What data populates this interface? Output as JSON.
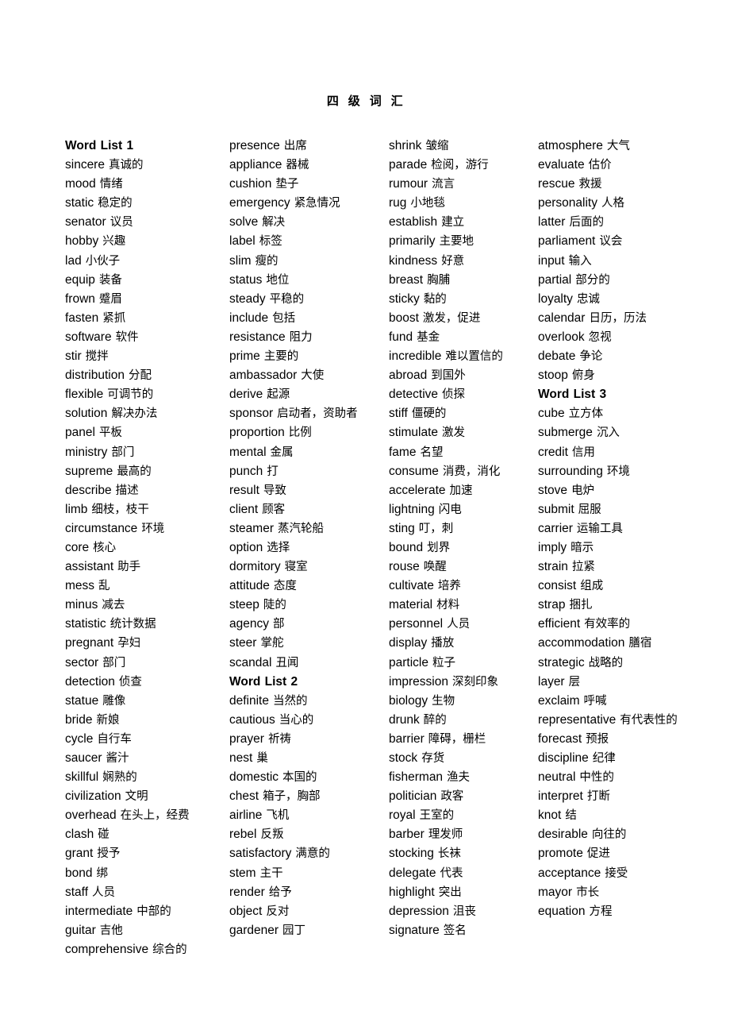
{
  "document": {
    "title": "四  级  词  汇"
  },
  "columns": [
    {
      "name": "column-1",
      "entries": [
        {
          "en": "Word List 1",
          "zh": "",
          "heading": true
        },
        {
          "en": "sincere",
          "zh": "真诚的"
        },
        {
          "en": "mood",
          "zh": "情绪"
        },
        {
          "en": "static",
          "zh": "稳定的"
        },
        {
          "en": "senator",
          "zh": "议员"
        },
        {
          "en": "hobby",
          "zh": "兴趣"
        },
        {
          "en": "lad",
          "zh": "小伙子"
        },
        {
          "en": "equip",
          "zh": "装备"
        },
        {
          "en": "frown",
          "zh": "蹙眉"
        },
        {
          "en": "fasten",
          "zh": "紧抓"
        },
        {
          "en": "software",
          "zh": "软件"
        },
        {
          "en": "stir",
          "zh": "搅拌"
        },
        {
          "en": "distribution",
          "zh": "分配"
        },
        {
          "en": "flexible",
          "zh": "可调节的"
        },
        {
          "en": "solution",
          "zh": "解决办法"
        },
        {
          "en": "panel",
          "zh": "平板"
        },
        {
          "en": "ministry",
          "zh": "部门"
        },
        {
          "en": "supreme",
          "zh": "最高的"
        },
        {
          "en": "describe",
          "zh": "描述"
        },
        {
          "en": "limb",
          "zh": "细枝，枝干"
        },
        {
          "en": "circumstance",
          "zh": "环境"
        },
        {
          "en": "core",
          "zh": "核心"
        },
        {
          "en": "assistant",
          "zh": "助手"
        },
        {
          "en": "mess",
          "zh": "乱"
        },
        {
          "en": "minus",
          "zh": "减去"
        },
        {
          "en": "statistic",
          "zh": "统计数据"
        },
        {
          "en": "pregnant",
          "zh": "孕妇"
        },
        {
          "en": "sector",
          "zh": "部门"
        },
        {
          "en": "detection",
          "zh": "侦查"
        },
        {
          "en": "statue",
          "zh": "雕像"
        },
        {
          "en": "bride",
          "zh": "新娘"
        },
        {
          "en": "cycle",
          "zh": "自行车"
        },
        {
          "en": "saucer",
          "zh": "酱汁"
        },
        {
          "en": "skillful",
          "zh": "娴熟的"
        },
        {
          "en": "civilization",
          "zh": "文明"
        },
        {
          "en": "overhead",
          "zh": "在头上，经费"
        },
        {
          "en": "clash",
          "zh": "碰"
        },
        {
          "en": "grant",
          "zh": "授予"
        },
        {
          "en": "bond",
          "zh": "绑"
        },
        {
          "en": "staff",
          "zh": "人员"
        },
        {
          "en": "intermediate",
          "zh": "中部的"
        },
        {
          "en": "guitar",
          "zh": "吉他"
        },
        {
          "en": "comprehensive",
          "zh": "综合的"
        }
      ]
    },
    {
      "name": "column-2",
      "entries": [
        {
          "en": "presence",
          "zh": "出席"
        },
        {
          "en": "appliance",
          "zh": "器械"
        },
        {
          "en": "cushion",
          "zh": "垫子"
        },
        {
          "en": "emergency",
          "zh": "紧急情况"
        },
        {
          "en": "solve",
          "zh": "解决"
        },
        {
          "en": "label",
          "zh": "标签"
        },
        {
          "en": "slim",
          "zh": "瘦的"
        },
        {
          "en": "status",
          "zh": "地位"
        },
        {
          "en": "steady",
          "zh": "平稳的"
        },
        {
          "en": "include",
          "zh": "包括"
        },
        {
          "en": "resistance",
          "zh": "阻力"
        },
        {
          "en": "prime",
          "zh": "主要的"
        },
        {
          "en": "ambassador",
          "zh": "大使"
        },
        {
          "en": "derive",
          "zh": "起源"
        },
        {
          "en": "sponsor",
          "zh": "启动者，资助者"
        },
        {
          "en": "proportion",
          "zh": "比例"
        },
        {
          "en": "mental",
          "zh": "金属"
        },
        {
          "en": "punch",
          "zh": "打"
        },
        {
          "en": "result",
          "zh": "导致"
        },
        {
          "en": "client",
          "zh": "顾客"
        },
        {
          "en": "steamer",
          "zh": "蒸汽轮船"
        },
        {
          "en": "option",
          "zh": "选择"
        },
        {
          "en": "dormitory",
          "zh": "寝室"
        },
        {
          "en": "attitude",
          "zh": "态度"
        },
        {
          "en": "steep",
          "zh": "陡的"
        },
        {
          "en": "agency",
          "zh": "部"
        },
        {
          "en": "steer",
          "zh": "掌舵"
        },
        {
          "en": "scandal",
          "zh": "丑闻"
        },
        {
          "en": "Word List 2",
          "zh": "",
          "heading": true
        },
        {
          "en": "definite",
          "zh": "当然的"
        },
        {
          "en": "cautious",
          "zh": "当心的"
        },
        {
          "en": "prayer",
          "zh": "祈祷"
        },
        {
          "en": "nest",
          "zh": "巢"
        },
        {
          "en": "domestic",
          "zh": "本国的"
        },
        {
          "en": "chest",
          "zh": "箱子，胸部"
        },
        {
          "en": "airline",
          "zh": "飞机"
        },
        {
          "en": "rebel",
          "zh": "反叛"
        },
        {
          "en": "satisfactory",
          "zh": "满意的"
        },
        {
          "en": "stem",
          "zh": "主干"
        },
        {
          "en": "render",
          "zh": "给予"
        },
        {
          "en": "object",
          "zh": "反对"
        },
        {
          "en": "gardener",
          "zh": "园丁"
        }
      ]
    },
    {
      "name": "column-3",
      "entries": [
        {
          "en": "shrink",
          "zh": "皱缩"
        },
        {
          "en": "parade",
          "zh": "检阅，游行"
        },
        {
          "en": "rumour",
          "zh": "流言"
        },
        {
          "en": "rug",
          "zh": "小地毯"
        },
        {
          "en": "establish",
          "zh": "建立"
        },
        {
          "en": "primarily",
          "zh": "主要地"
        },
        {
          "en": "kindness",
          "zh": "好意"
        },
        {
          "en": "breast",
          "zh": "胸脯"
        },
        {
          "en": "sticky",
          "zh": "黏的"
        },
        {
          "en": "boost",
          "zh": "激发，促进"
        },
        {
          "en": "fund",
          "zh": "基金"
        },
        {
          "en": "incredible",
          "zh": "难以置信的"
        },
        {
          "en": "abroad",
          "zh": "到国外"
        },
        {
          "en": "detective",
          "zh": "侦探"
        },
        {
          "en": "stiff",
          "zh": "僵硬的"
        },
        {
          "en": "stimulate",
          "zh": "激发"
        },
        {
          "en": "fame",
          "zh": "名望"
        },
        {
          "en": "consume",
          "zh": "消费，消化"
        },
        {
          "en": "accelerate",
          "zh": "加速"
        },
        {
          "en": "lightning",
          "zh": "闪电"
        },
        {
          "en": "sting",
          "zh": "叮，刺"
        },
        {
          "en": "bound",
          "zh": "划界"
        },
        {
          "en": "rouse",
          "zh": "唤醒"
        },
        {
          "en": "cultivate",
          "zh": "培养"
        },
        {
          "en": "material",
          "zh": "材料"
        },
        {
          "en": "personnel",
          "zh": "人员"
        },
        {
          "en": "display",
          "zh": "播放"
        },
        {
          "en": "particle",
          "zh": "粒子"
        },
        {
          "en": "impression",
          "zh": "深刻印象"
        },
        {
          "en": "biology",
          "zh": "生物"
        },
        {
          "en": "drunk",
          "zh": "醉的"
        },
        {
          "en": "barrier",
          "zh": "障碍，栅栏"
        },
        {
          "en": "stock",
          "zh": "存货"
        },
        {
          "en": "fisherman",
          "zh": "渔夫"
        },
        {
          "en": "politician",
          "zh": "政客"
        },
        {
          "en": "royal",
          "zh": "王室的"
        },
        {
          "en": "barber",
          "zh": "理发师"
        },
        {
          "en": "stocking",
          "zh": "长袜"
        },
        {
          "en": "delegate",
          "zh": "代表"
        },
        {
          "en": "highlight",
          "zh": "突出"
        },
        {
          "en": "depression",
          "zh": "沮丧"
        },
        {
          "en": "signature",
          "zh": "签名"
        }
      ]
    },
    {
      "name": "column-4",
      "entries": [
        {
          "en": "atmosphere",
          "zh": "大气"
        },
        {
          "en": "evaluate",
          "zh": "估价"
        },
        {
          "en": "rescue",
          "zh": "救援"
        },
        {
          "en": "personality",
          "zh": "人格"
        },
        {
          "en": "latter",
          "zh": "后面的"
        },
        {
          "en": "parliament",
          "zh": "议会"
        },
        {
          "en": "input",
          "zh": "输入"
        },
        {
          "en": "partial",
          "zh": "部分的"
        },
        {
          "en": "loyalty",
          "zh": "忠诚"
        },
        {
          "en": "calendar",
          "zh": "日历，历法"
        },
        {
          "en": "overlook",
          "zh": "忽视"
        },
        {
          "en": "debate",
          "zh": "争论"
        },
        {
          "en": "stoop",
          "zh": "俯身"
        },
        {
          "en": "Word List 3",
          "zh": "",
          "heading": true
        },
        {
          "en": "cube",
          "zh": "立方体"
        },
        {
          "en": "submerge",
          "zh": "沉入"
        },
        {
          "en": "credit",
          "zh": "信用"
        },
        {
          "en": "surrounding",
          "zh": "环境"
        },
        {
          "en": "stove",
          "zh": "电炉"
        },
        {
          "en": "submit",
          "zh": "屈服"
        },
        {
          "en": "carrier",
          "zh": "运输工具"
        },
        {
          "en": "imply",
          "zh": "暗示"
        },
        {
          "en": "strain",
          "zh": "拉紧"
        },
        {
          "en": "consist",
          "zh": "组成"
        },
        {
          "en": "strap",
          "zh": "捆扎"
        },
        {
          "en": "efficient",
          "zh": "有效率的"
        },
        {
          "en": "accommodation",
          "zh": "膳宿"
        },
        {
          "en": "strategic",
          "zh": "战略的"
        },
        {
          "en": "layer",
          "zh": "层"
        },
        {
          "en": "exclaim",
          "zh": "呼喊"
        },
        {
          "en": "representative",
          "zh": "有代表性的"
        },
        {
          "en": "forecast",
          "zh": "预报"
        },
        {
          "en": "discipline",
          "zh": "纪律"
        },
        {
          "en": "neutral",
          "zh": "中性的"
        },
        {
          "en": "interpret",
          "zh": "打断"
        },
        {
          "en": "knot",
          "zh": "结"
        },
        {
          "en": "desirable",
          "zh": "向往的"
        },
        {
          "en": "promote",
          "zh": "促进"
        },
        {
          "en": "acceptance",
          "zh": "接受"
        },
        {
          "en": "mayor",
          "zh": "市长"
        },
        {
          "en": "equation",
          "zh": "方程"
        }
      ]
    }
  ]
}
